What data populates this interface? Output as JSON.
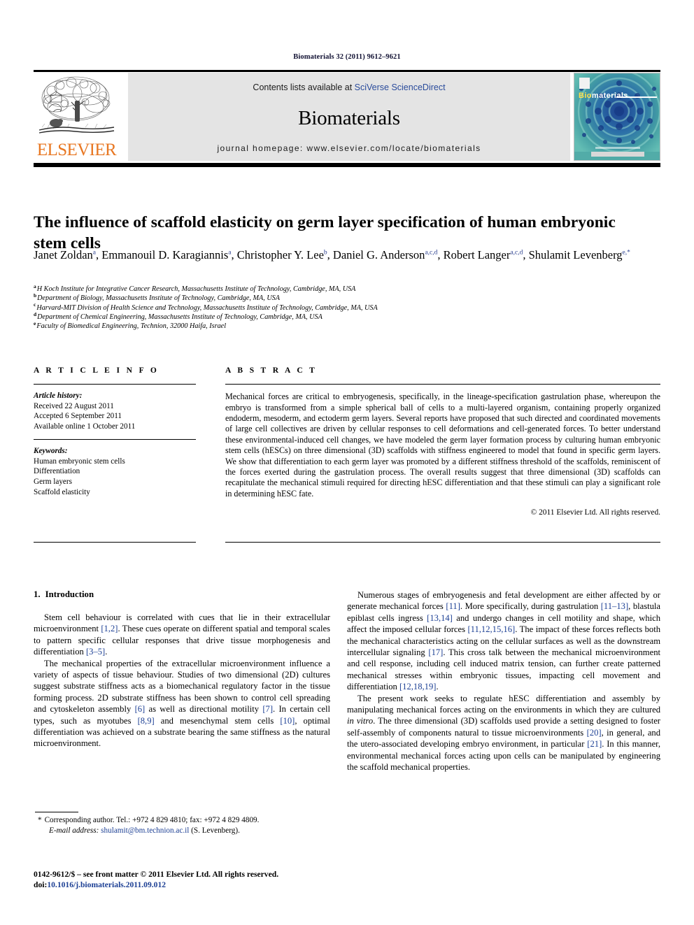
{
  "running_head": "Biomaterials 32 (2011) 9612–9621",
  "masthead": {
    "publisher_logo_text": "ELSEVIER",
    "contents_prefix": "Contents lists available at ",
    "contents_link": "SciVerse ScienceDirect",
    "journal_name": "Biomaterials",
    "homepage_label": "journal homepage: www.elsevier.com/locate/biomaterials",
    "cover_title_a": "Bio",
    "cover_title_b": "materials"
  },
  "article": {
    "title": "The influence of scaffold elasticity on germ layer specification of human embryonic stem cells",
    "authors_html": "Janet Zoldan<sup>a</sup>, Emmanouil D. Karagiannis<sup>a</sup>, Christopher Y. Lee<sup>b</sup>, Daniel G. Anderson<sup>a,c,d</sup>, Robert Langer<sup>a,c,d</sup>, Shulamit Levenberg<sup>e,*</sup>",
    "affiliations": [
      {
        "marker": "a",
        "text": "H Koch Institute for Integrative Cancer Research, Massachusetts Institute of Technology, Cambridge, MA, USA"
      },
      {
        "marker": "b",
        "text": "Department of Biology, Massachusetts Institute of Technology, Cambridge, MA, USA"
      },
      {
        "marker": "c",
        "text": "Harvard-MIT Division of Health Science and Technology, Massachusetts Institute of Technology, Cambridge, MA, USA"
      },
      {
        "marker": "d",
        "text": "Department of Chemical Engineering, Massachusetts Institute of Technology, Cambridge, MA, USA"
      },
      {
        "marker": "e",
        "text": "Faculty of Biomedical Engineering, Technion, 32000 Haifa, Israel"
      }
    ]
  },
  "article_info": {
    "heading": "A R T I C L E   I N F O",
    "history_label": "Article history:",
    "history": [
      "Received 22 August 2011",
      "Accepted 6 September 2011",
      "Available online 1 October 2011"
    ],
    "keywords_label": "Keywords:",
    "keywords": [
      "Human embryonic stem cells",
      "Differentiation",
      "Germ layers",
      "Scaffold elasticity"
    ]
  },
  "abstract": {
    "heading": "A B S T R A C T",
    "text": "Mechanical forces are critical to embryogenesis, specifically, in the lineage-specification gastrulation phase, whereupon the embryo is transformed from a simple spherical ball of cells to a multi-layered organism, containing properly organized endoderm, mesoderm, and ectoderm germ layers. Several reports have proposed that such directed and coordinated movements of large cell collectives are driven by cellular responses to cell deformations and cell-generated forces. To better understand these environmental-induced cell changes, we have modeled the germ layer formation process by culturing human embryonic stem cells (hESCs) on three dimensional (3D) scaffolds with stiffness engineered to model that found in specific germ layers. We show that differentiation to each germ layer was promoted by a different stiffness threshold of the scaffolds, reminiscent of the forces exerted during the gastrulation process. The overall results suggest that three dimensional (3D) scaffolds can recapitulate the mechanical stimuli required for directing hESC differentiation and that these stimuli can play a significant role in determining hESC fate.",
    "copyright": "© 2011 Elsevier Ltd. All rights reserved."
  },
  "body": {
    "section_number": "1.",
    "section_title": "Introduction",
    "left_paragraphs_html": [
      "Stem cell behaviour is correlated with cues that lie in their extracellular microenvironment <span class=\"ref\">[1,2]</span>. These cues operate on different spatial and temporal scales to pattern specific cellular responses that drive tissue morphogenesis and differentiation <span class=\"ref\">[3&ndash;5]</span>.",
      "The mechanical properties of the extracellular microenvironment influence a variety of aspects of tissue behaviour. Studies of two dimensional (2D) cultures suggest substrate stiffness acts as a biomechanical regulatory factor in the tissue forming process. 2D substrate stiffness has been shown to control cell spreading and cytoskeleton assembly <span class=\"ref\">[6]</span> as well as directional motility <span class=\"ref\">[7]</span>. In certain cell types, such as myotubes <span class=\"ref\">[8,9]</span> and mesenchymal stem cells <span class=\"ref\">[10]</span>, optimal differentiation was achieved on a substrate bearing the same stiffness as the natural microenvironment."
    ],
    "right_paragraphs_html": [
      "Numerous stages of embryogenesis and fetal development are either affected by or generate mechanical forces <span class=\"ref\">[11]</span>. More specifically, during gastrulation <span class=\"ref\">[11&ndash;13]</span>, blastula epiblast cells ingress <span class=\"ref\">[13,14]</span> and undergo changes in cell motility and shape, which affect the imposed cellular forces <span class=\"ref\">[11,12,15,16]</span>. The impact of these forces reflects both the mechanical characteristics acting on the cellular surfaces as well as the downstream intercellular signaling <span class=\"ref\">[17]</span>. This cross talk between the mechanical microenvironment and cell response, including cell induced matrix tension, can further create patterned mechanical stresses within embryonic tissues, impacting cell movement and differentiation <span class=\"ref\">[12,18,19]</span>.",
      "The present work seeks to regulate hESC differentiation and assembly by manipulating mechanical forces acting on the environments in which they are cultured <i>in vitro</i>. The three dimensional (3D) scaffolds used provide a setting designed to foster self-assembly of components natural to tissue microenvironments <span class=\"ref\">[20]</span>, in general, and the utero-associated developing embryo environment, in particular <span class=\"ref\">[21]</span>. In this manner, environmental mechanical forces acting upon cells can be manipulated by engineering the scaffold mechanical properties."
    ]
  },
  "footnotes": {
    "corresponding_marker": "*",
    "corresponding_text": "Corresponding author. Tel.: +972 4 829 4810; fax: +972 4 829 4809.",
    "email_label": "E-mail address:",
    "email": "shulamit@bm.technion.ac.il",
    "email_suffix": "(S. Levenberg).",
    "issn_line": "0142-9612/$ – see front matter © 2011 Elsevier Ltd. All rights reserved.",
    "doi_label": "doi:",
    "doi": "10.1016/j.biomaterials.2011.09.012"
  },
  "colors": {
    "link": "#1c3f94",
    "elsevier_orange": "#E87722",
    "banner_bg": "#e4e4e4",
    "cover_teal": "#4fa9a6"
  }
}
